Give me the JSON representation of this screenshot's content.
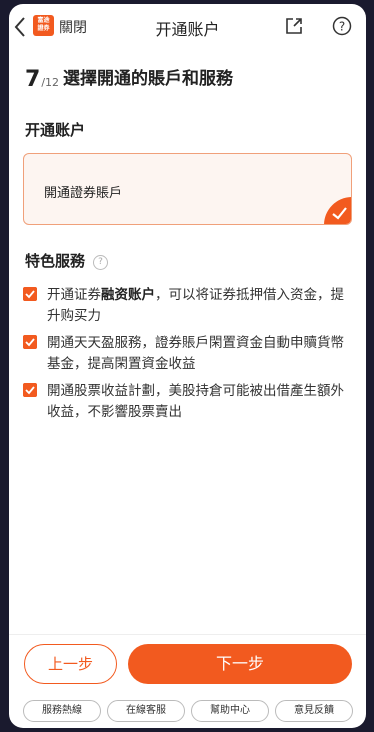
{
  "nav": {
    "logo_text": "富途證券",
    "close_label": "關閉",
    "title": "开通账户"
  },
  "step": {
    "current": "7",
    "total": "/12",
    "title": "選擇開通的賬戶和服務"
  },
  "account_section": {
    "label": "开通账户",
    "card_label": "開通證券賬戶",
    "checked": true
  },
  "features": {
    "label": "特色服務",
    "help_icon": "?",
    "options": [
      {
        "prefix": "开通证券",
        "bold": "融资账户",
        "suffix": "，可以将证券抵押借入资金，提升购买力",
        "checked": true
      },
      {
        "prefix": "開通天天盈服務，證券賬戶閑置資金自動申贖貨幣基金，提高閑置資金收益",
        "bold": "",
        "suffix": "",
        "checked": true
      },
      {
        "prefix": "開通股票收益計劃，美股持倉可能被出借產生額外收益，不影響股票賣出",
        "bold": "",
        "suffix": "",
        "checked": true
      }
    ]
  },
  "footer": {
    "prev_label": "上一步",
    "next_label": "下一步",
    "links": [
      "服務熱線",
      "在線客服",
      "幫助中心",
      "意見反饋"
    ]
  },
  "colors": {
    "accent": "#f25a1f",
    "card_bg": "#fdf5f1"
  }
}
